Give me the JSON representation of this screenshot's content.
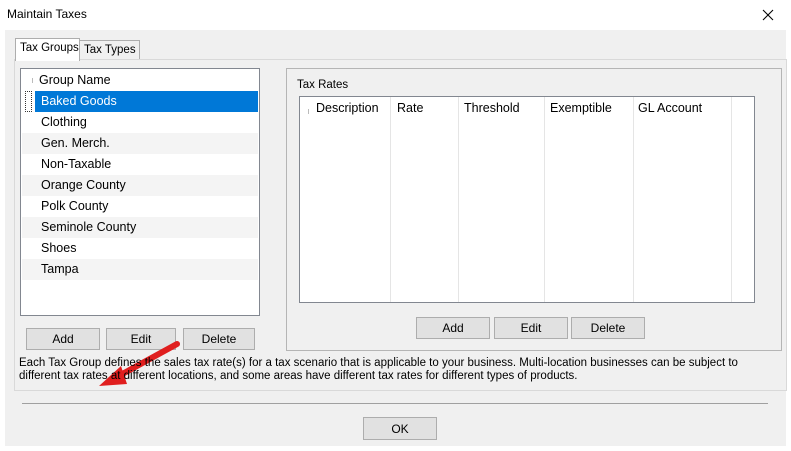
{
  "window": {
    "title": "Maintain Taxes",
    "close_glyph": "✕"
  },
  "tabs": [
    {
      "label": "Tax Groups",
      "active": true
    },
    {
      "label": "Tax Types",
      "active": false
    }
  ],
  "groups": {
    "header": "Group Name",
    "items": [
      {
        "label": "Baked Goods",
        "selected": true
      },
      {
        "label": "Clothing"
      },
      {
        "label": "Gen. Merch."
      },
      {
        "label": "Non-Taxable"
      },
      {
        "label": "Orange County"
      },
      {
        "label": "Polk County"
      },
      {
        "label": "Seminole County"
      },
      {
        "label": "Shoes"
      },
      {
        "label": "Tampa"
      }
    ],
    "buttons": {
      "add": "Add",
      "edit": "Edit",
      "delete": "Delete"
    }
  },
  "tax_rates": {
    "label": "Tax Rates",
    "columns": [
      "Description",
      "Rate",
      "Threshold",
      "Exemptible",
      "GL Account"
    ],
    "buttons": {
      "add": "Add",
      "edit": "Edit",
      "delete": "Delete"
    }
  },
  "description": "Each Tax Group defines the sales tax rate(s) for a tax scenario that is applicable to your business. Multi-location businesses can be subject to different tax rates at different locations, and some areas have different tax rates for different types of products.",
  "footer": {
    "ok": "OK"
  },
  "colors": {
    "selection": "#0078d7",
    "arrow": "#e01e1e",
    "dialog_bg": "#f0f0f0"
  },
  "icons": {
    "close": "close-icon",
    "annotation": "red-arrow-icon"
  }
}
